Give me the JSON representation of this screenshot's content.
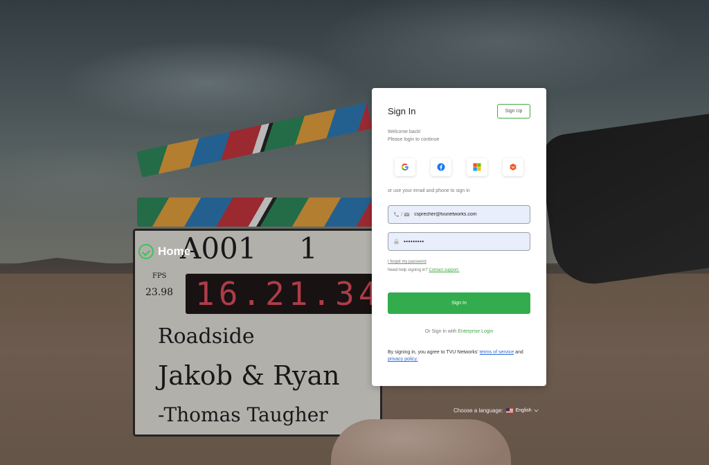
{
  "brand": {
    "home_label": "Home"
  },
  "signin_card": {
    "title": "Sign In",
    "signup_label": "Sign Up",
    "welcome_line1": "Welcome back!",
    "welcome_line2": "Please login to continue",
    "social_providers": [
      "google-icon",
      "facebook-icon",
      "microsoft-icon",
      "tvu-icon"
    ],
    "alt_signin_text": "or use your email and phone to sign in",
    "email_value": "csprecher@tvunetworks.com",
    "password_value": "•••••••••",
    "forgot_label": "I forgot my password",
    "help_text": "Need help signing in?",
    "contact_label": "Contact support.",
    "signin_button": "Sign In",
    "enterprise_prefix": "Or Sign in with",
    "enterprise_link": "Enterprise Login",
    "terms_prefix": "By signing in, you agree to TVU Networks'",
    "terms_link": "terms of service",
    "terms_and": "and",
    "privacy_link": "privacy policy."
  },
  "language": {
    "label": "Choose a language:",
    "selected": "English"
  },
  "background": {
    "clapper_timecode": "16.21.34",
    "fps_label": "FPS",
    "fps_value": "23.98",
    "roll": "A001",
    "scene": "1",
    "prod": "Roadside",
    "dir": "Jakob & Ryan",
    "cam": "-Thomas Taugher"
  },
  "colors": {
    "accent": "#33ac4d",
    "field_bg": "#e8eefb"
  }
}
